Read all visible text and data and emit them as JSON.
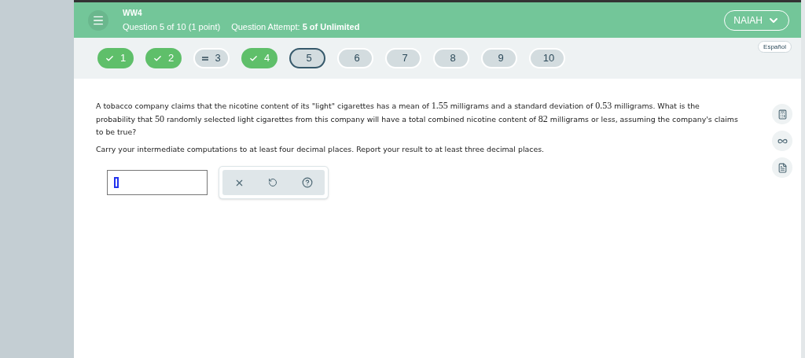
{
  "header": {
    "assignment": "WW4",
    "question_info": "Question 5 of 10 (1 point)",
    "attempt_label": "Question Attempt:",
    "attempt_value": "5 of Unlimited",
    "user": "NAIAH"
  },
  "language_button": "Español",
  "questions": [
    {
      "label": "1",
      "kind": "correct",
      "selected": false
    },
    {
      "label": "2",
      "kind": "correct",
      "selected": false
    },
    {
      "label": "3",
      "kind": "partial",
      "selected": false
    },
    {
      "label": "4",
      "kind": "correct",
      "selected": false
    },
    {
      "label": "5",
      "kind": "blank",
      "selected": true
    },
    {
      "label": "6",
      "kind": "blank",
      "selected": false
    },
    {
      "label": "7",
      "kind": "blank",
      "selected": false
    },
    {
      "label": "8",
      "kind": "blank",
      "selected": false
    },
    {
      "label": "9",
      "kind": "blank",
      "selected": false
    },
    {
      "label": "10",
      "kind": "blank",
      "selected": false
    }
  ],
  "problem": [
    {
      "kind": "text",
      "text": "A tobacco company claims that the nicotine content of its \"light\" cigarettes has a mean of "
    },
    {
      "kind": "math",
      "text": "1.55"
    },
    {
      "kind": "text",
      "text": " milligrams and a standard deviation of "
    },
    {
      "kind": "math",
      "text": "0.53"
    },
    {
      "kind": "text",
      "text": " milligrams. What is the probability that "
    },
    {
      "kind": "math",
      "text": "50"
    },
    {
      "kind": "text",
      "text": " randomly selected light cigarettes from this company will have a total combined nicotine content of "
    },
    {
      "kind": "math",
      "text": "82"
    },
    {
      "kind": "text",
      "text": " milligrams or less, assuming the company's claims to be true?"
    }
  ],
  "instructions": "Carry your intermediate computations to at least four decimal places. Report your result to at least three decimal places."
}
